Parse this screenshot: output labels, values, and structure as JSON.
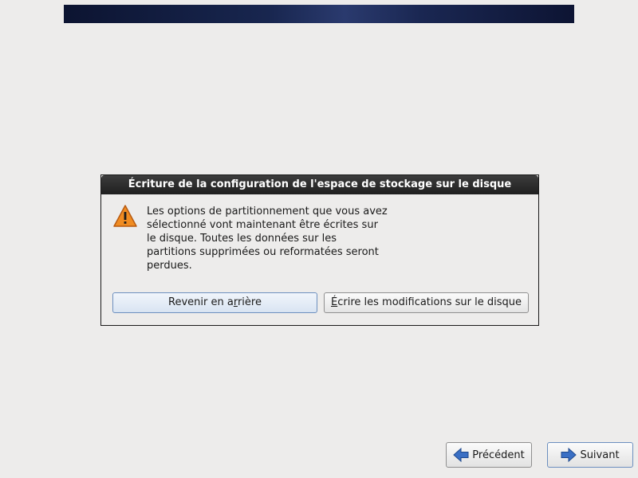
{
  "dialog": {
    "title": "Écriture de la configuration de l'espace de stockage sur le disque",
    "message_lines": [
      "Les options de partitionnement que vous avez",
      "sélectionné vont maintenant être écrites sur",
      "le disque. Toutes les données sur les",
      "partitions supprimées ou reformatées seront",
      "perdues."
    ],
    "back_button": {
      "before": "Revenir en a",
      "mnemonic": "r",
      "after": "rière"
    },
    "write_button": {
      "before": "",
      "mnemonic": "É",
      "after": "crire les modifications sur le disque"
    },
    "icon": "warning-icon"
  },
  "nav": {
    "previous_label": "Précédent",
    "next_label": "Suivant",
    "previous_icon": "arrow-left-icon",
    "next_icon": "arrow-right-icon"
  },
  "colors": {
    "background": "#edeceb",
    "banner": "#18264f",
    "title_bar": "#2b2b2b",
    "warning": "#f08c22",
    "arrow": "#3a6fc4"
  }
}
